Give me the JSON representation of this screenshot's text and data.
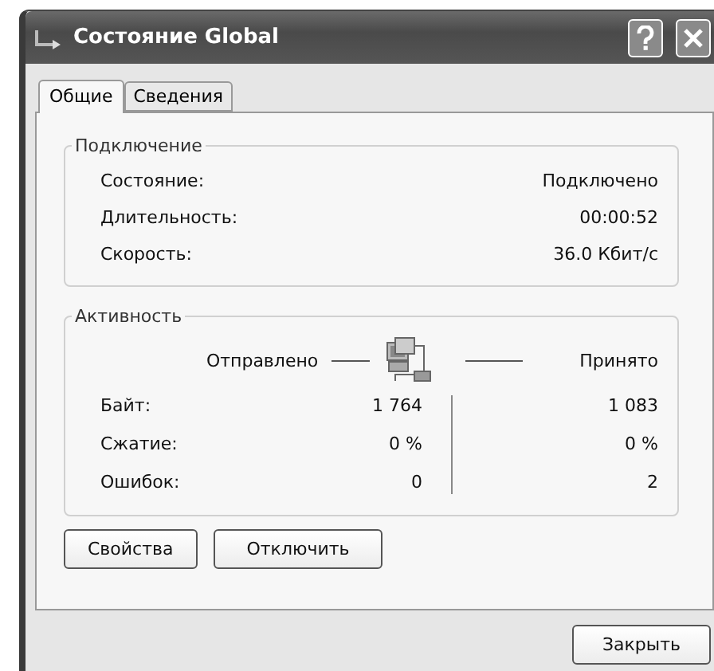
{
  "window": {
    "title": "Состояние Global"
  },
  "tabs": [
    {
      "label": "Общие",
      "selected": true
    },
    {
      "label": "Сведения",
      "selected": false
    }
  ],
  "connection": {
    "title": "Подключение",
    "rows": [
      {
        "label": "Состояние:",
        "value": "Подключено"
      },
      {
        "label": "Длительность:",
        "value": "00:00:52"
      },
      {
        "label": "Скорость:",
        "value": "36.0 Кбит/с"
      }
    ]
  },
  "activity": {
    "title": "Активность",
    "sent_label": "Отправлено",
    "received_label": "Принято",
    "rows": [
      {
        "label": "Байт:",
        "sent": "1 764",
        "received": "1 083"
      },
      {
        "label": "Сжатие:",
        "sent": "0 %",
        "received": "0 %"
      },
      {
        "label": "Ошибок:",
        "sent": "0",
        "received": "2"
      }
    ]
  },
  "buttons": [
    "Свойства",
    "Отключить"
  ],
  "close_button": "Закрыть"
}
